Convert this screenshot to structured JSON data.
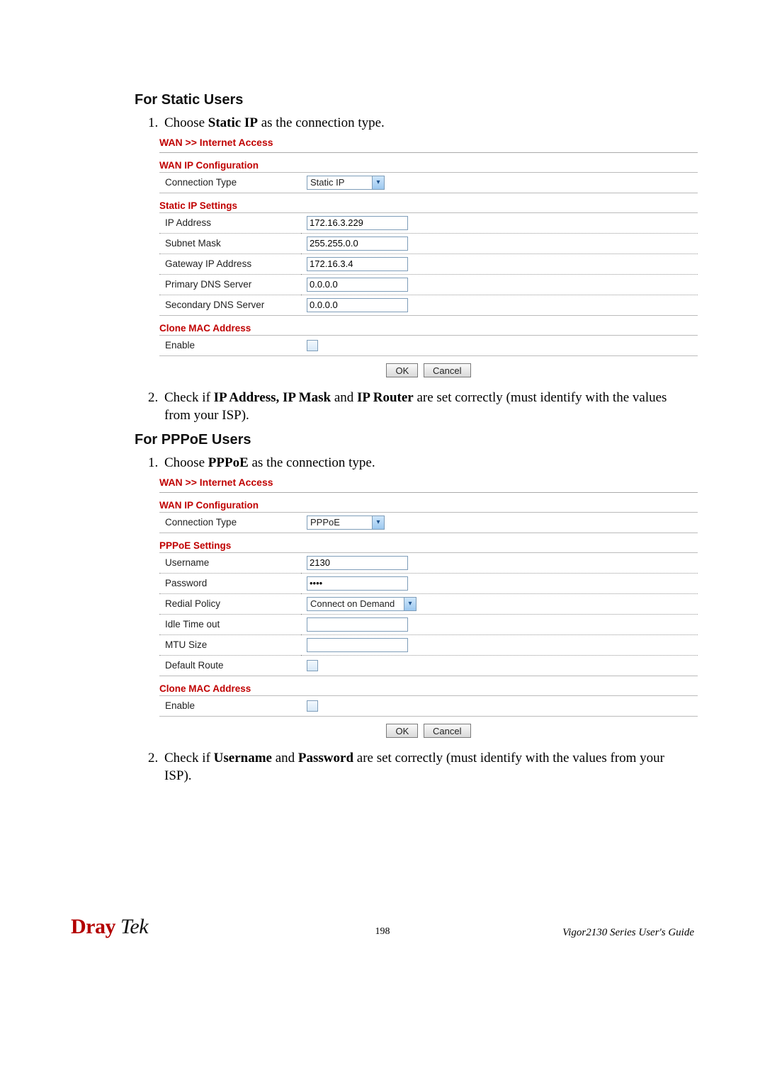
{
  "sections": {
    "static": {
      "heading": "For Static Users",
      "step1_pre": "Choose ",
      "step1_bold": "Static IP",
      "step1_post": " as the connection type.",
      "step2_pre": "Check if ",
      "step2_bold1": "IP Address, IP Mask",
      "step2_mid": " and ",
      "step2_bold2": "IP Router",
      "step2_post": " are set correctly (must identify with the values from your ISP)."
    },
    "pppoe": {
      "heading": "For PPPoE Users",
      "step1_pre": "Choose ",
      "step1_bold": "PPPoE",
      "step1_post": " as the connection type.",
      "step2_pre": "Check if ",
      "step2_bold1": "Username",
      "step2_mid": " and ",
      "step2_bold2": "Password",
      "step2_post": " are set correctly (must identify with the values from your ISP)."
    }
  },
  "ui": {
    "breadcrumb": "WAN >> Internet Access",
    "wan_ip_conf": "WAN IP Configuration",
    "conn_type_label": "Connection Type",
    "clone_mac": "Clone MAC Address",
    "enable_label": "Enable",
    "ok": "OK",
    "cancel": "Cancel"
  },
  "static_ui": {
    "conn_type_value": "Static IP",
    "section": "Static IP Settings",
    "rows": {
      "ip_label": "IP Address",
      "ip_value": "172.16.3.229",
      "mask_label": "Subnet Mask",
      "mask_value": "255.255.0.0",
      "gw_label": "Gateway IP Address",
      "gw_value": "172.16.3.4",
      "dns1_label": "Primary DNS Server",
      "dns1_value": "0.0.0.0",
      "dns2_label": "Secondary DNS Server",
      "dns2_value": "0.0.0.0"
    }
  },
  "pppoe_ui": {
    "conn_type_value": "PPPoE",
    "section": "PPPoE Settings",
    "rows": {
      "user_label": "Username",
      "user_value": "2130",
      "pass_label": "Password",
      "pass_value": "••••",
      "redial_label": "Redial Policy",
      "redial_value": "Connect on Demand",
      "idle_label": "Idle Time out",
      "idle_value": "",
      "mtu_label": "MTU Size",
      "mtu_value": "",
      "defroute_label": "Default Route"
    }
  },
  "footer": {
    "brand_d": "Dray",
    "brand_rest": " Tek",
    "page": "198",
    "guide": "Vigor2130  Series  User's  Guide"
  }
}
